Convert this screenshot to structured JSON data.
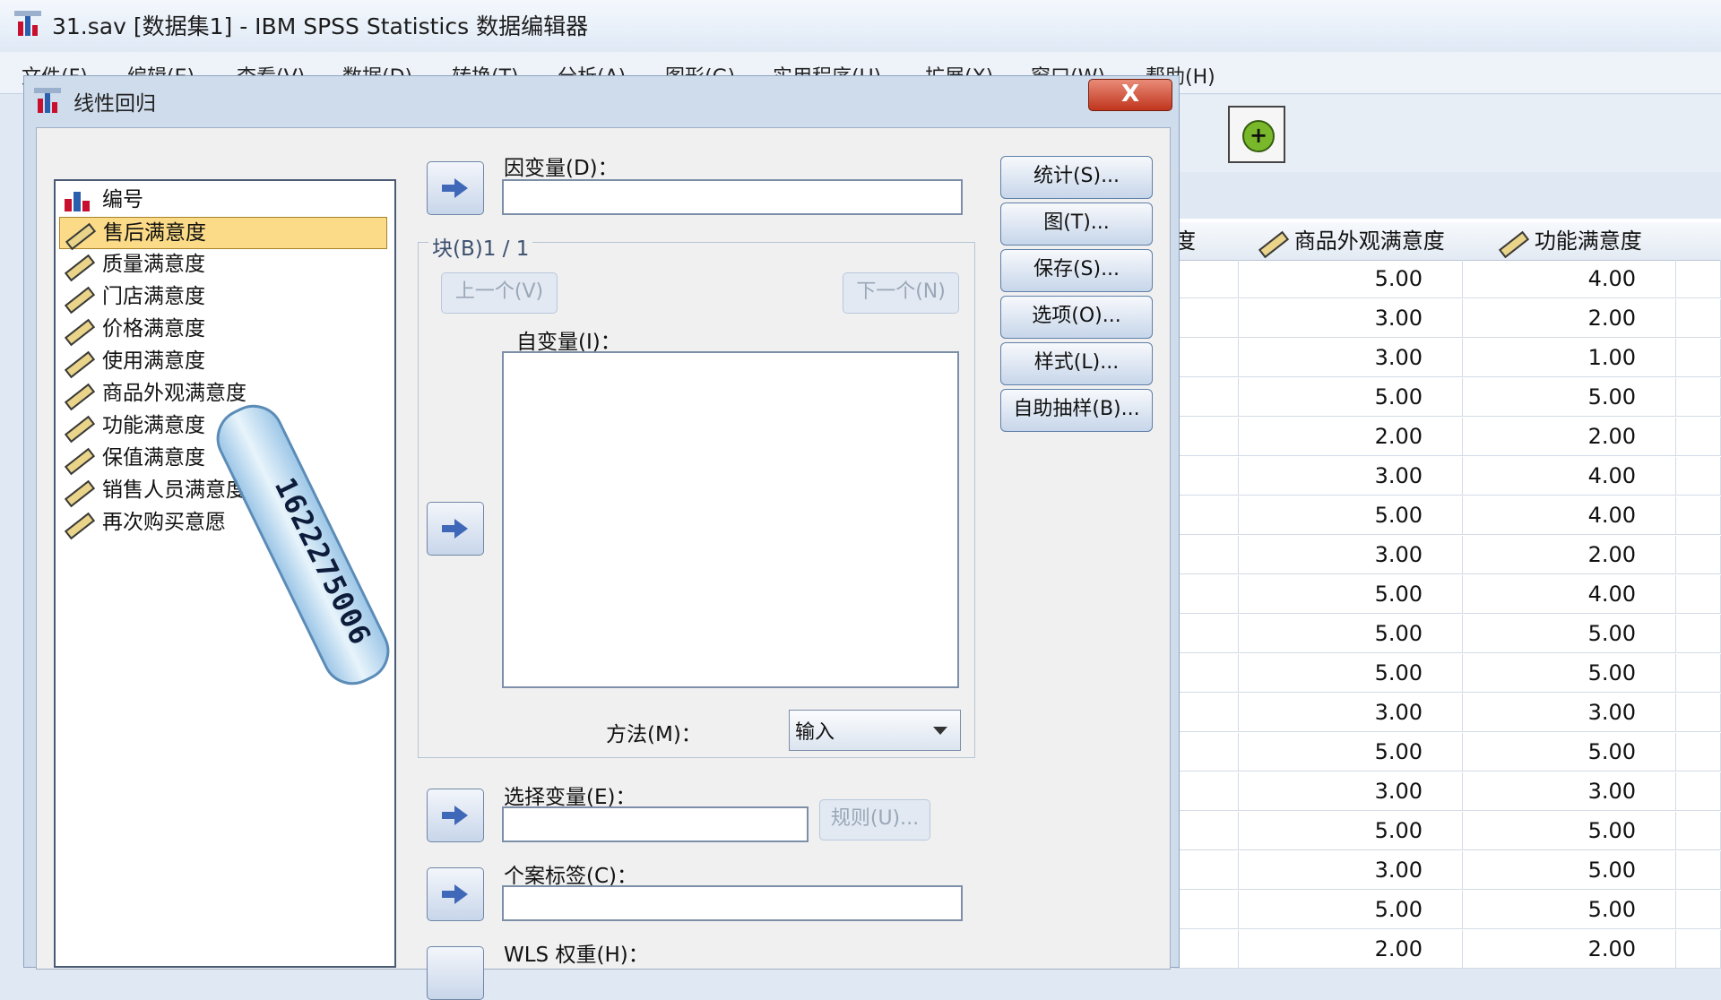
{
  "main_window": {
    "title": "31.sav [数据集1] - IBM SPSS Statistics 数据编辑器",
    "menu": [
      "文件(F)",
      "编辑(E)",
      "查看(V)",
      "数据(D)",
      "转换(T)",
      "分析(A)",
      "图形(G)",
      "实用程序(U)",
      "扩展(X)",
      "窗口(W)",
      "帮助(H)"
    ],
    "grid": {
      "columns": [
        "度",
        "商品外观满意度",
        "功能满意度"
      ],
      "rows": [
        [
          "5.00",
          "4.00"
        ],
        [
          "3.00",
          "2.00"
        ],
        [
          "3.00",
          "1.00"
        ],
        [
          "5.00",
          "5.00"
        ],
        [
          "2.00",
          "2.00"
        ],
        [
          "3.00",
          "4.00"
        ],
        [
          "5.00",
          "4.00"
        ],
        [
          "3.00",
          "2.00"
        ],
        [
          "5.00",
          "4.00"
        ],
        [
          "5.00",
          "5.00"
        ],
        [
          "5.00",
          "5.00"
        ],
        [
          "3.00",
          "3.00"
        ],
        [
          "5.00",
          "5.00"
        ],
        [
          "3.00",
          "3.00"
        ],
        [
          "5.00",
          "5.00"
        ],
        [
          "3.00",
          "5.00"
        ],
        [
          "5.00",
          "5.00"
        ],
        [
          "2.00",
          "2.00"
        ]
      ]
    }
  },
  "dialog": {
    "title": "线性回归",
    "close_label": "X",
    "variables": [
      {
        "label": "编号",
        "icon": "scale-bars-icon"
      },
      {
        "label": "售后满意度",
        "icon": "ruler-icon",
        "selected": true
      },
      {
        "label": "质量满意度",
        "icon": "ruler-icon"
      },
      {
        "label": "门店满意度",
        "icon": "ruler-icon"
      },
      {
        "label": "价格满意度",
        "icon": "ruler-icon"
      },
      {
        "label": "使用满意度",
        "icon": "ruler-icon"
      },
      {
        "label": "商品外观满意度",
        "icon": "ruler-icon"
      },
      {
        "label": "功能满意度",
        "icon": "ruler-icon"
      },
      {
        "label": "保值满意度",
        "icon": "ruler-icon"
      },
      {
        "label": "销售人员满意度",
        "icon": "ruler-icon"
      },
      {
        "label": "再次购买意愿",
        "icon": "ruler-icon"
      }
    ],
    "dependent_label": "因变量(D)：",
    "block_label": "块(B)1 / 1",
    "prev_button": "上一个(V)",
    "next_button": "下一个(N)",
    "independent_label": "自变量(I)：",
    "method_label": "方法(M)：",
    "method_value": "输入",
    "selection_label": "选择变量(E)：",
    "rule_button": "规则(U)...",
    "case_label": "个案标签(C)：",
    "wls_label": "WLS 权重(H)：",
    "side_buttons": [
      "统计(S)...",
      "图(T)...",
      "保存(S)...",
      "选项(O)...",
      "样式(L)...",
      "自助抽样(B)..."
    ],
    "watermark_text": "1622275006"
  }
}
